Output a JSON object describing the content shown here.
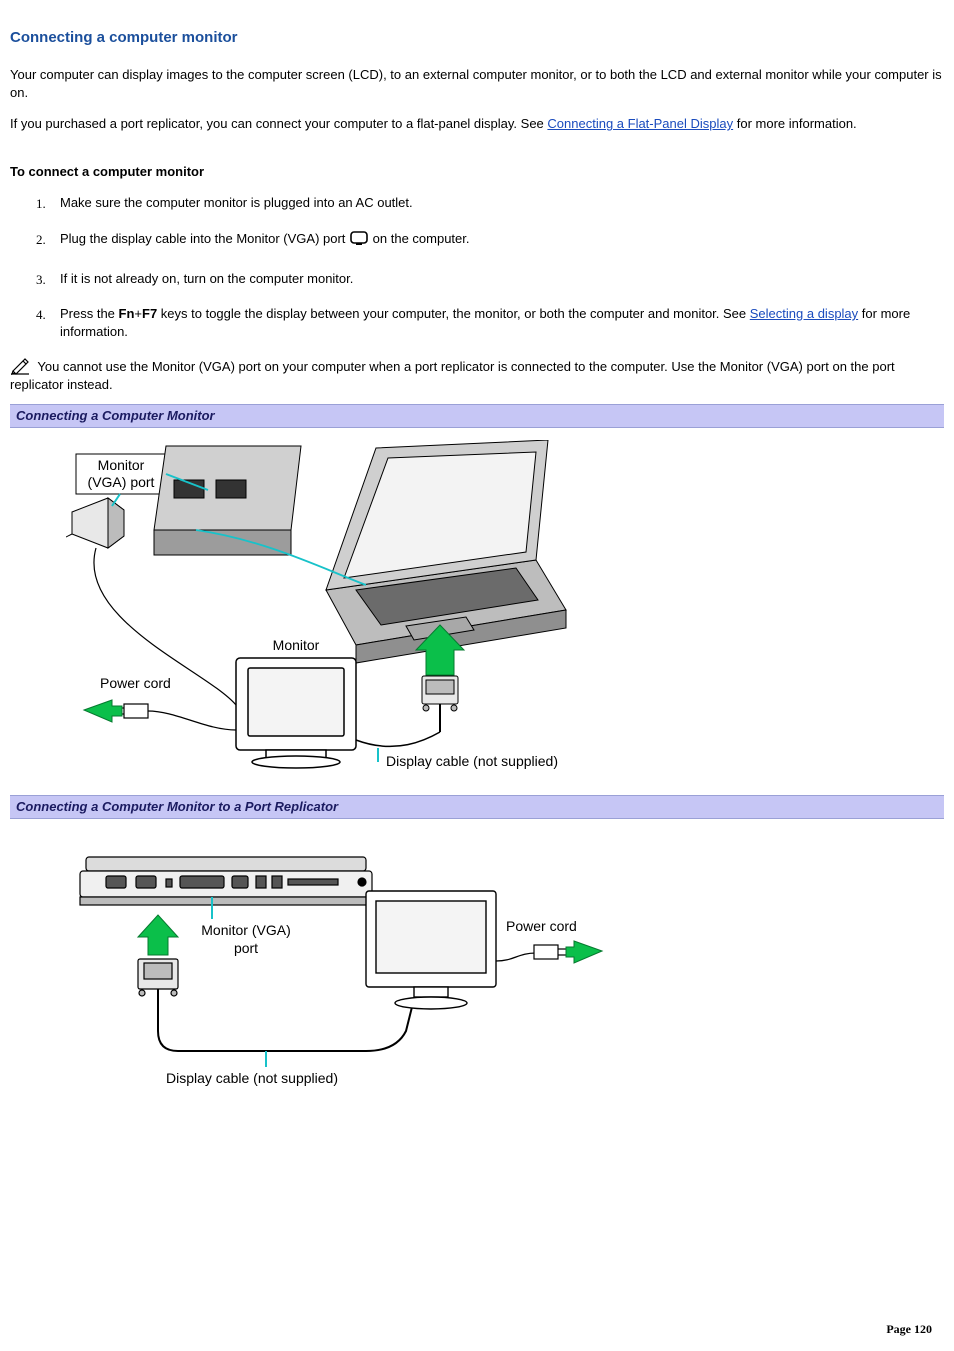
{
  "title": "Connecting a computer monitor",
  "intro1": "Your computer can display images to the computer screen (LCD), to an external computer monitor, or to both the LCD and external monitor while your computer is on.",
  "intro2_a": "If you purchased a port replicator, you can connect your computer to a flat-panel display. See ",
  "intro2_link": "Connecting a Flat-Panel Display",
  "intro2_b": " for more information.",
  "subhead": "To connect a computer monitor",
  "steps": {
    "s1": "Make sure the computer monitor is plugged into an AC outlet.",
    "s2_a": "Plug the display cable into the Monitor (VGA) port ",
    "s2_b": " on the computer.",
    "s3": "If it is not already on, turn on the computer monitor.",
    "s4_a": "Press the ",
    "s4_fn": "Fn",
    "s4_plus": "+",
    "s4_f7": "F7",
    "s4_b": " keys to toggle the display between your computer, the monitor, or both the computer and monitor. See ",
    "s4_link": "Selecting a display",
    "s4_c": " for more information."
  },
  "note": "You cannot use the Monitor (VGA) port on your computer when a port replicator is connected to the computer. Use the Monitor (VGA) port on the port replicator instead.",
  "caption1": "Connecting a Computer Monitor",
  "fig1": {
    "lbl_vga_a": "Monitor",
    "lbl_vga_b": "(VGA) port",
    "lbl_monitor": "Monitor",
    "lbl_power": "Power cord",
    "lbl_cable": "Display cable (not supplied)"
  },
  "caption2": "Connecting a Computer Monitor to a Port Replicator",
  "fig2": {
    "lbl_vga_a": "Monitor (VGA)",
    "lbl_vga_b": "port",
    "lbl_power": "Power cord",
    "lbl_cable": "Display cable (not supplied)"
  },
  "page_number": "Page 120"
}
